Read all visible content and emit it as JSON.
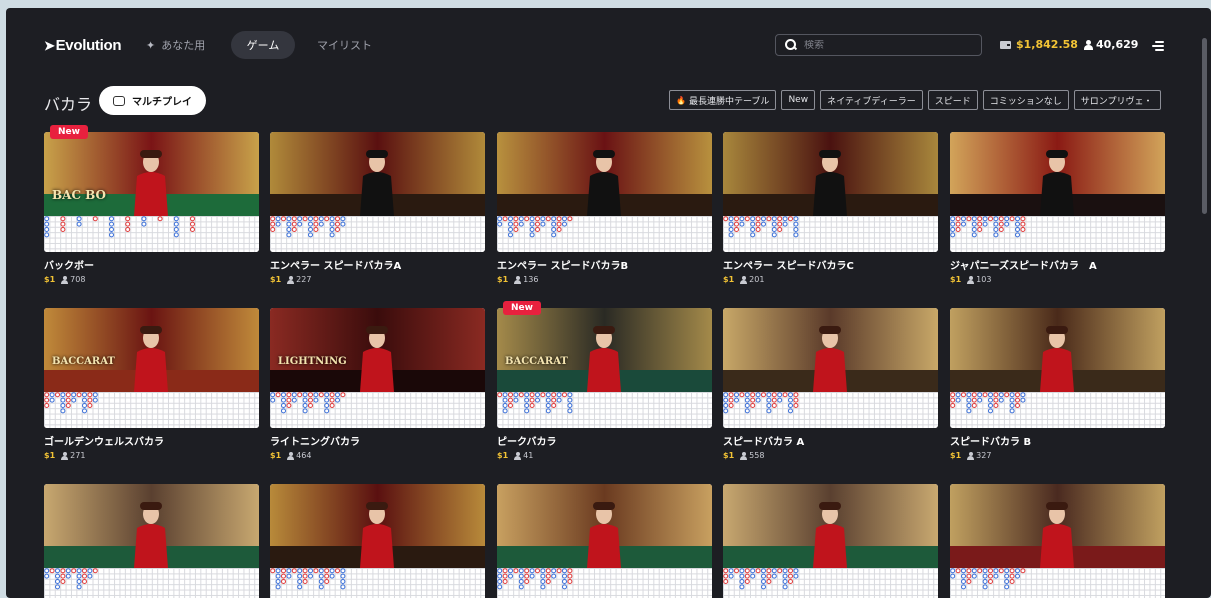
{
  "header": {
    "logo": "Evolution",
    "nav": {
      "for_you": "あなた用",
      "game": "ゲーム",
      "my_list": "マイリスト"
    },
    "search_placeholder": "検索",
    "balance": "$1,842.58",
    "players": "40,629"
  },
  "section": {
    "title": "バカラ",
    "multiplay_label": "マルチプレイ",
    "filters": [
      "最長連勝中テーブル",
      "New",
      "ネイティブディーラー",
      "スピード",
      "コミッションなし",
      "サロンプリヴェ・"
    ]
  },
  "badge_new_label": "New",
  "games": [
    {
      "title": "バックボー",
      "min": "$1",
      "players": "708",
      "new": true,
      "overlay": "BAC BO"
    },
    {
      "title": "エンペラー スピードバカラA",
      "min": "$1",
      "players": "227",
      "new": false
    },
    {
      "title": "エンペラー スピードバカラB",
      "min": "$1",
      "players": "136",
      "new": false
    },
    {
      "title": "エンペラー スピードバカラC",
      "min": "$1",
      "players": "201",
      "new": false
    },
    {
      "title": "ジャパニーズスピードバカラ　A",
      "min": "$1",
      "players": "103",
      "new": false
    },
    {
      "title": "ゴールデンウェルスバカラ",
      "min": "$1",
      "players": "271",
      "new": false,
      "overlay": "BACCARAT"
    },
    {
      "title": "ライトニングバカラ",
      "min": "$1",
      "players": "464",
      "new": false,
      "overlay": "LIGHTNING"
    },
    {
      "title": "ピークバカラ",
      "min": "$1",
      "players": "41",
      "new": true,
      "overlay": "BACCARAT"
    },
    {
      "title": "スピードバカラ A",
      "min": "$1",
      "players": "558",
      "new": false
    },
    {
      "title": "スピードバカラ B",
      "min": "$1",
      "players": "327",
      "new": false
    },
    {
      "title": "",
      "min": "",
      "players": "",
      "new": false
    },
    {
      "title": "",
      "min": "",
      "players": "",
      "new": false
    },
    {
      "title": "",
      "min": "",
      "players": "",
      "new": false
    },
    {
      "title": "",
      "min": "",
      "players": "",
      "new": false
    },
    {
      "title": "",
      "min": "",
      "players": "",
      "new": false
    }
  ],
  "colors": {
    "accent_gold": "#f2c335",
    "badge_red": "#e8213e",
    "banker_red": "#e03a3a",
    "player_blue": "#3a6fd8"
  }
}
